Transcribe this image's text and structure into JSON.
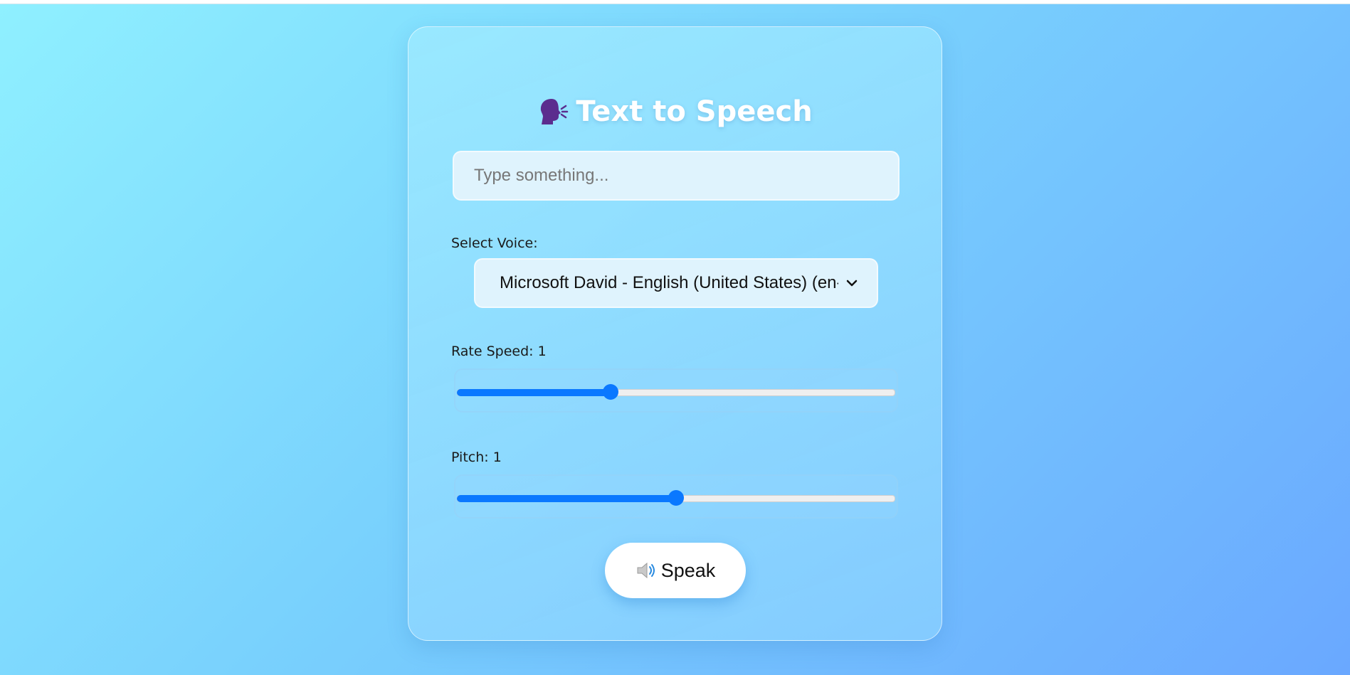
{
  "app": {
    "title": "Text to Speech"
  },
  "text_input": {
    "placeholder": "Type something...",
    "value": ""
  },
  "voice": {
    "label": "Select Voice:",
    "selected": "Microsoft David - English (United States) (en-US)"
  },
  "rate": {
    "label": "Rate Speed: 1",
    "value": 1,
    "fill_fraction": 0.35
  },
  "pitch": {
    "label": "Pitch: 1",
    "value": 1,
    "fill_fraction": 0.5
  },
  "speak_button": {
    "label": "Speak",
    "icon": "speaker-icon"
  },
  "colors": {
    "accent": "#0a78ff",
    "title_icon": "#5b2d8e"
  }
}
